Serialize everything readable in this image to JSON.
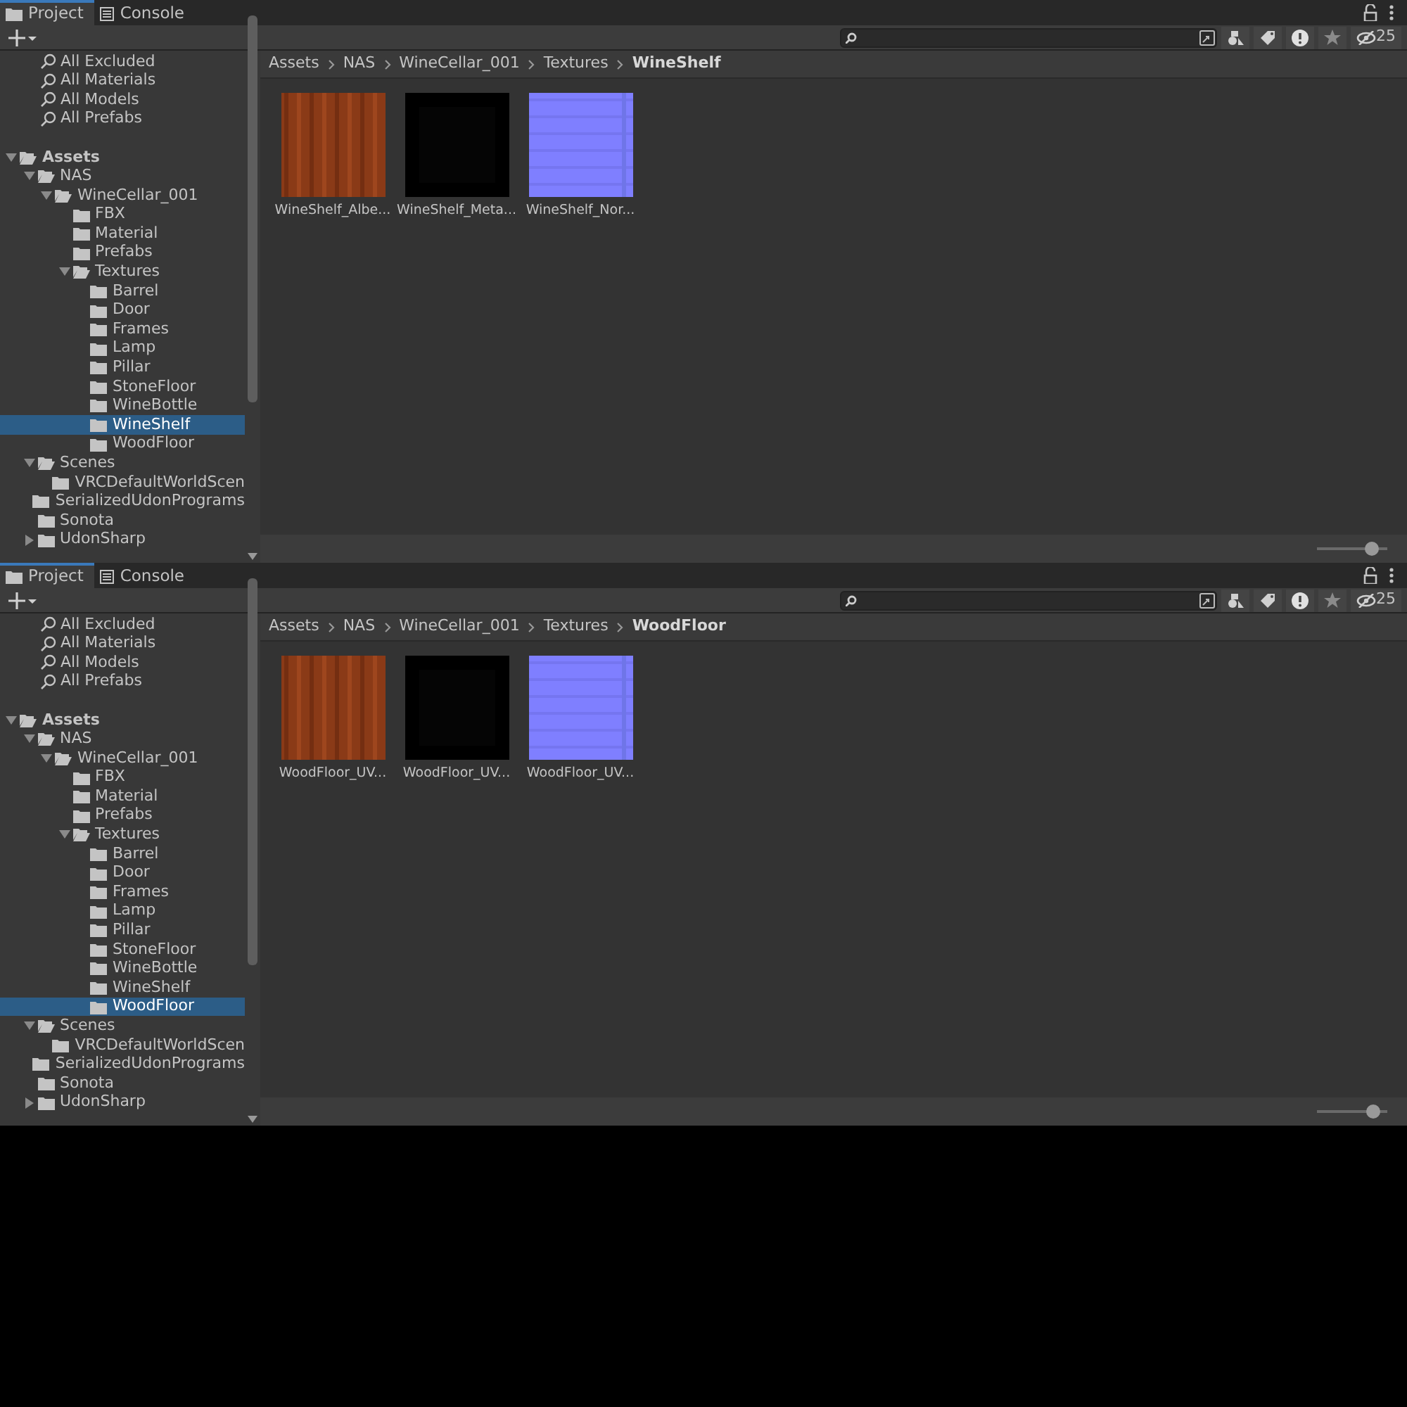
{
  "panels": [
    {
      "tabs": [
        {
          "label": "Project",
          "selected": true
        },
        {
          "label": "Console",
          "selected": false
        }
      ],
      "hidden_count": "25",
      "favorites": [
        {
          "label": "All Excluded"
        },
        {
          "label": "All Materials"
        },
        {
          "label": "All Models"
        },
        {
          "label": "All Prefabs"
        }
      ],
      "tree": [
        {
          "label": "Assets",
          "expanded": true,
          "selected": false,
          "children": [
            {
              "label": "NAS",
              "expanded": true,
              "selected": false,
              "children": [
                {
                  "label": "WineCellar_001",
                  "expanded": true,
                  "selected": false,
                  "children": [
                    {
                      "label": "FBX",
                      "selected": false
                    },
                    {
                      "label": "Material",
                      "selected": false
                    },
                    {
                      "label": "Prefabs",
                      "selected": false
                    },
                    {
                      "label": "Textures",
                      "expanded": true,
                      "selected": false,
                      "children": [
                        {
                          "label": "Barrel",
                          "selected": false
                        },
                        {
                          "label": "Door",
                          "selected": false
                        },
                        {
                          "label": "Frames",
                          "selected": false
                        },
                        {
                          "label": "Lamp",
                          "selected": false
                        },
                        {
                          "label": "Pillar",
                          "selected": false
                        },
                        {
                          "label": "StoneFloor",
                          "selected": false
                        },
                        {
                          "label": "WineBottle",
                          "selected": false
                        },
                        {
                          "label": "WineShelf",
                          "selected": true
                        },
                        {
                          "label": "WoodFloor",
                          "selected": false
                        }
                      ]
                    }
                  ]
                }
              ]
            },
            {
              "label": "Scenes",
              "expanded": true,
              "selected": false,
              "children": [
                {
                  "label": "VRCDefaultWorldScen",
                  "selected": false
                }
              ]
            },
            {
              "label": "SerializedUdonPrograms",
              "selected": false
            },
            {
              "label": "Sonota",
              "selected": false
            },
            {
              "label": "UdonSharp",
              "expanded": false,
              "selected": false
            }
          ]
        }
      ],
      "breadcrumb": [
        "Assets",
        "NAS",
        "WineCellar_001",
        "Textures",
        "WineShelf"
      ],
      "assets": [
        {
          "name": "WineShelf_Albe...",
          "kind": "wood"
        },
        {
          "name": "WineShelf_Meta...",
          "kind": "black"
        },
        {
          "name": "WineShelf_Nor...",
          "kind": "normal"
        }
      ],
      "zoom_slider": {
        "level": 0.78
      }
    },
    {
      "tabs": [
        {
          "label": "Project",
          "selected": true
        },
        {
          "label": "Console",
          "selected": false
        }
      ],
      "hidden_count": "25",
      "favorites": [
        {
          "label": "All Excluded"
        },
        {
          "label": "All Materials"
        },
        {
          "label": "All Models"
        },
        {
          "label": "All Prefabs"
        }
      ],
      "tree": [
        {
          "label": "Assets",
          "expanded": true,
          "selected": false,
          "children": [
            {
              "label": "NAS",
              "expanded": true,
              "selected": false,
              "children": [
                {
                  "label": "WineCellar_001",
                  "expanded": true,
                  "selected": false,
                  "children": [
                    {
                      "label": "FBX",
                      "selected": false
                    },
                    {
                      "label": "Material",
                      "selected": false
                    },
                    {
                      "label": "Prefabs",
                      "selected": false
                    },
                    {
                      "label": "Textures",
                      "expanded": true,
                      "selected": false,
                      "children": [
                        {
                          "label": "Barrel",
                          "selected": false
                        },
                        {
                          "label": "Door",
                          "selected": false
                        },
                        {
                          "label": "Frames",
                          "selected": false
                        },
                        {
                          "label": "Lamp",
                          "selected": false
                        },
                        {
                          "label": "Pillar",
                          "selected": false
                        },
                        {
                          "label": "StoneFloor",
                          "selected": false
                        },
                        {
                          "label": "WineBottle",
                          "selected": false
                        },
                        {
                          "label": "WineShelf",
                          "selected": false
                        },
                        {
                          "label": "WoodFloor",
                          "selected": true
                        }
                      ]
                    }
                  ]
                }
              ]
            },
            {
              "label": "Scenes",
              "expanded": true,
              "selected": false,
              "children": [
                {
                  "label": "VRCDefaultWorldScen",
                  "selected": false
                }
              ]
            },
            {
              "label": "SerializedUdonPrograms",
              "selected": false
            },
            {
              "label": "Sonota",
              "selected": false
            },
            {
              "label": "UdonSharp",
              "expanded": false,
              "selected": false
            }
          ]
        }
      ],
      "breadcrumb": [
        "Assets",
        "NAS",
        "WineCellar_001",
        "Textures",
        "WoodFloor"
      ],
      "assets": [
        {
          "name": "WoodFloor_UV...",
          "kind": "wood"
        },
        {
          "name": "WoodFloor_UV...",
          "kind": "black"
        },
        {
          "name": "WoodFloor_UV...",
          "kind": "normal"
        }
      ],
      "zoom_slider": {
        "level": 0.8
      }
    }
  ]
}
